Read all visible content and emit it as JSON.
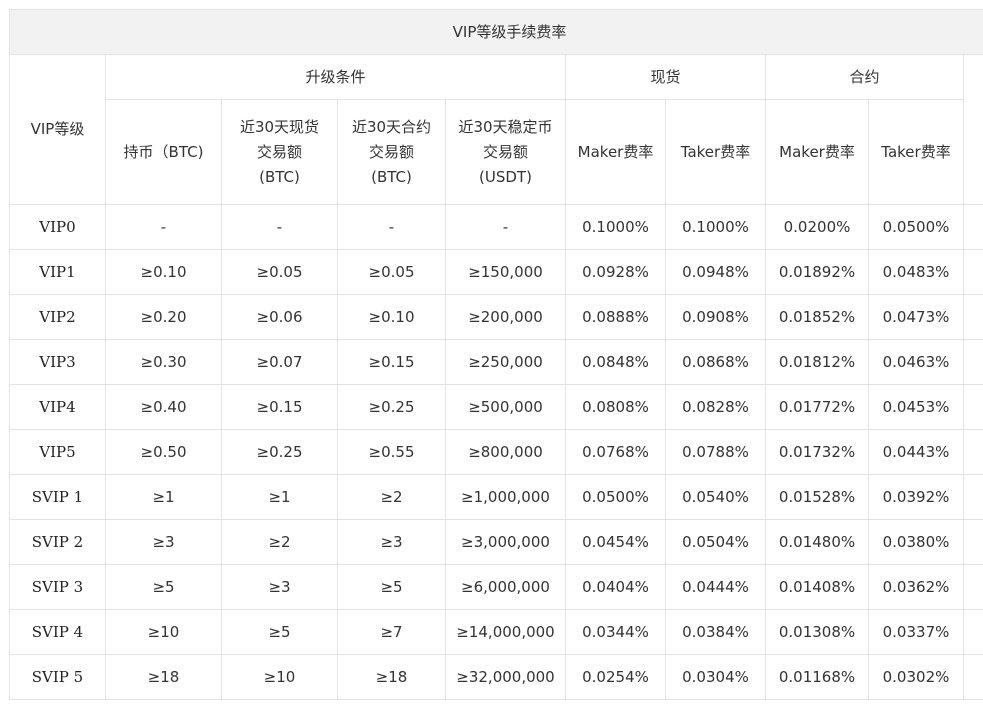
{
  "table": {
    "title": "VIP等级手续费率",
    "level_header": "VIP等级",
    "groups": {
      "upgrade": "升级条件",
      "spot": "现货",
      "contract": "合约"
    },
    "sub_headers": {
      "hold_btc": [
        "持币（BTC)"
      ],
      "spot_volume": [
        "近30天现货",
        "交易额",
        "(BTC)"
      ],
      "contract_volume": [
        "近30天合约",
        "交易额",
        "(BTC)"
      ],
      "stable_volume": [
        "近30天稳定币",
        "交易额",
        "(USDT)"
      ],
      "spot_maker": [
        "Maker费率"
      ],
      "spot_taker": [
        "Taker费率"
      ],
      "contract_maker": [
        "Maker费率"
      ],
      "contract_taker": [
        "Taker费率"
      ]
    },
    "rows": [
      {
        "level": "VIP0",
        "hold": "-",
        "spot_vol": "-",
        "contract_vol": "-",
        "stable_vol": "-",
        "spot_maker": "0.1000%",
        "spot_taker": "0.1000%",
        "contract_maker": "0.0200%",
        "contract_taker": "0.0500%"
      },
      {
        "level": "VIP1",
        "hold": "≥0.10",
        "spot_vol": "≥0.05",
        "contract_vol": "≥0.05",
        "stable_vol": "≥150,000",
        "spot_maker": "0.0928%",
        "spot_taker": "0.0948%",
        "contract_maker": "0.01892%",
        "contract_taker": "0.0483%"
      },
      {
        "level": "VIP2",
        "hold": "≥0.20",
        "spot_vol": "≥0.06",
        "contract_vol": "≥0.10",
        "stable_vol": "≥200,000",
        "spot_maker": "0.0888%",
        "spot_taker": "0.0908%",
        "contract_maker": "0.01852%",
        "contract_taker": "0.0473%"
      },
      {
        "level": "VIP3",
        "hold": "≥0.30",
        "spot_vol": "≥0.07",
        "contract_vol": "≥0.15",
        "stable_vol": "≥250,000",
        "spot_maker": "0.0848%",
        "spot_taker": "0.0868%",
        "contract_maker": "0.01812%",
        "contract_taker": "0.0463%"
      },
      {
        "level": "VIP4",
        "hold": "≥0.40",
        "spot_vol": "≥0.15",
        "contract_vol": "≥0.25",
        "stable_vol": "≥500,000",
        "spot_maker": "0.0808%",
        "spot_taker": "0.0828%",
        "contract_maker": "0.01772%",
        "contract_taker": "0.0453%"
      },
      {
        "level": "VIP5",
        "hold": "≥0.50",
        "spot_vol": "≥0.25",
        "contract_vol": "≥0.55",
        "stable_vol": "≥800,000",
        "spot_maker": "0.0768%",
        "spot_taker": "0.0788%",
        "contract_maker": "0.01732%",
        "contract_taker": "0.0443%"
      },
      {
        "level": "SVIP 1",
        "hold": "≥1",
        "spot_vol": "≥1",
        "contract_vol": "≥2",
        "stable_vol": "≥1,000,000",
        "spot_maker": "0.0500%",
        "spot_taker": "0.0540%",
        "contract_maker": "0.01528%",
        "contract_taker": "0.0392%"
      },
      {
        "level": "SVIP 2",
        "hold": "≥3",
        "spot_vol": "≥2",
        "contract_vol": "≥3",
        "stable_vol": "≥3,000,000",
        "spot_maker": "0.0454%",
        "spot_taker": "0.0504%",
        "contract_maker": "0.01480%",
        "contract_taker": "0.0380%"
      },
      {
        "level": "SVIP 3",
        "hold": "≥5",
        "spot_vol": "≥3",
        "contract_vol": "≥5",
        "stable_vol": "≥6,000,000",
        "spot_maker": "0.0404%",
        "spot_taker": "0.0444%",
        "contract_maker": "0.01408%",
        "contract_taker": "0.0362%"
      },
      {
        "level": "SVIP 4",
        "hold": "≥10",
        "spot_vol": "≥5",
        "contract_vol": "≥7",
        "stable_vol": "≥14,000,000",
        "spot_maker": "0.0344%",
        "spot_taker": "0.0384%",
        "contract_maker": "0.01308%",
        "contract_taker": "0.0337%"
      },
      {
        "level": "SVIP 5",
        "hold": "≥18",
        "spot_vol": "≥10",
        "contract_vol": "≥18",
        "stable_vol": "≥32,000,000",
        "spot_maker": "0.0254%",
        "spot_taker": "0.0304%",
        "contract_maker": "0.01168%",
        "contract_taker": "0.0302%"
      }
    ]
  }
}
